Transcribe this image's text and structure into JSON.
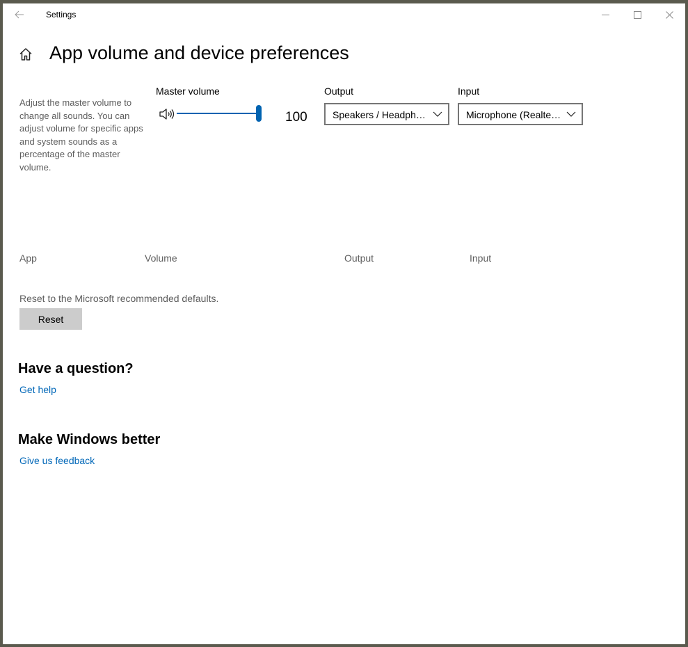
{
  "window": {
    "title": "Settings"
  },
  "page": {
    "title": "App volume and device preferences",
    "description": "Adjust the master volume to change all sounds. You can adjust volume for specific apps and system sounds as a percentage of the master volume."
  },
  "master": {
    "label": "Master volume",
    "value": "100",
    "level_percent": 100
  },
  "output": {
    "label": "Output",
    "selected": "Speakers / Headphones (Realtek(R) Audio)"
  },
  "input": {
    "label": "Input",
    "selected": "Microphone (Realtek(R) Audio)"
  },
  "table_headers": {
    "app": "App",
    "volume": "Volume",
    "output": "Output",
    "input": "Input"
  },
  "reset": {
    "description": "Reset to the Microsoft recommended defaults.",
    "button_label": "Reset"
  },
  "question": {
    "heading": "Have a question?",
    "link": "Get help"
  },
  "feedback": {
    "heading": "Make Windows better",
    "link": "Give us feedback"
  },
  "colors": {
    "accent": "#0063b1",
    "link": "#0067b8",
    "secondary_text": "#5d5d5d"
  }
}
